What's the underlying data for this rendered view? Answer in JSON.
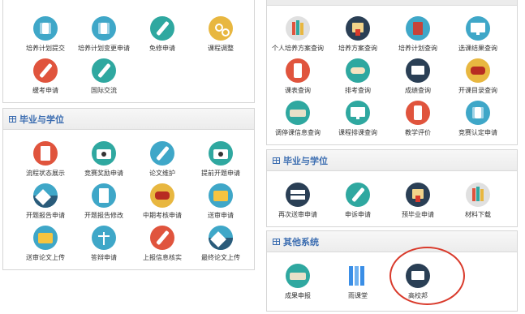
{
  "left_top": {
    "items": [
      {
        "label": "培养计划提交",
        "icon": "building-icon",
        "color": "#3fa7c8"
      },
      {
        "label": "培养计划变更申请",
        "icon": "building-icon",
        "color": "#3fa7c8"
      },
      {
        "label": "免修申请",
        "icon": "pen-icon",
        "color": "#2fa8a0"
      },
      {
        "label": "课程调整",
        "icon": "scissors-icon",
        "color": "#e8b740"
      },
      {
        "label": "缓考申请",
        "icon": "pen-icon",
        "color": "#e0543d"
      },
      {
        "label": "国际交流",
        "icon": "pen-icon",
        "color": "#2fa8a0"
      }
    ]
  },
  "left_grad": {
    "title": "毕业与学位",
    "items": [
      {
        "label": "流程状态展示",
        "icon": "document-icon",
        "color": "#e0543d"
      },
      {
        "label": "竞赛奖励申请",
        "icon": "camera-icon",
        "color": "#2fa8a0"
      },
      {
        "label": "论文维护",
        "icon": "pen-icon",
        "color": "#3fa7c8"
      },
      {
        "label": "提前开题申请",
        "icon": "camera-icon",
        "color": "#2fa8a0"
      },
      {
        "label": "开题报告申请",
        "icon": "mountain-icon",
        "color": "#3fa7c8"
      },
      {
        "label": "开题报告修改",
        "icon": "document-icon",
        "color": "#3fa7c8"
      },
      {
        "label": "中期考核申请",
        "icon": "bow-icon",
        "color": "#e8b740"
      },
      {
        "label": "送审申请",
        "icon": "folder-icon",
        "color": "#3fa7c8"
      },
      {
        "label": "送审论文上传",
        "icon": "folder-icon",
        "color": "#3fa7c8"
      },
      {
        "label": "答辩申请",
        "icon": "windmill-icon",
        "color": "#3fa7c8"
      },
      {
        "label": "上报信息核实",
        "icon": "pen-icon",
        "color": "#e0543d"
      },
      {
        "label": "最终论文上传",
        "icon": "mountain-icon",
        "color": "#3fa7c8"
      }
    ]
  },
  "right_top": {
    "items": [
      {
        "label": "个人培养方案查询",
        "icon": "books-icon",
        "color": "#e0e0e0"
      },
      {
        "label": "培养方案查询",
        "icon": "certificate-icon",
        "color": "#2a3f55"
      },
      {
        "label": "培养计划查询",
        "icon": "book-icon",
        "color": "#3fa7c8"
      },
      {
        "label": "选课结果查询",
        "icon": "monitor-icon",
        "color": "#3fa7c8"
      },
      {
        "label": "课表查询",
        "icon": "phone-icon",
        "color": "#e0543d"
      },
      {
        "label": "排考查询",
        "icon": "handshake-icon",
        "color": "#2fa8a0"
      },
      {
        "label": "成绩查询",
        "icon": "mail-icon",
        "color": "#2a3f55"
      },
      {
        "label": "开课目录查询",
        "icon": "bow-icon",
        "color": "#e8b740"
      },
      {
        "label": "调停课信息查询",
        "icon": "keyboard-icon",
        "color": "#2fa8a0"
      },
      {
        "label": "课程排课查询",
        "icon": "monitor-icon",
        "color": "#2fa8a0"
      },
      {
        "label": "教学评价",
        "icon": "phone-icon",
        "color": "#e0543d"
      },
      {
        "label": "竞赛认定申请",
        "icon": "building-icon",
        "color": "#3fa7c8"
      }
    ]
  },
  "right_grad": {
    "title": "毕业与学位",
    "items": [
      {
        "label": "再次送审申请",
        "icon": "server-icon",
        "color": "#2a3f55"
      },
      {
        "label": "申诉申请",
        "icon": "pen-icon",
        "color": "#2fa8a0"
      },
      {
        "label": "预毕业申请",
        "icon": "certificate-icon",
        "color": "#2a3f55"
      },
      {
        "label": "材料下载",
        "icon": "books-icon",
        "color": "#e0e0e0"
      }
    ]
  },
  "right_other": {
    "title": "其他系统",
    "items": [
      {
        "label": "成果申报",
        "icon": "keyboard-icon",
        "color": "#2fa8a0"
      },
      {
        "label": "雨课堂",
        "icon": "rain-classroom-icon",
        "color": "#3a8ee6"
      },
      {
        "label": "高校邦",
        "icon": "mail-icon",
        "color": "#2a3f55"
      }
    ]
  }
}
